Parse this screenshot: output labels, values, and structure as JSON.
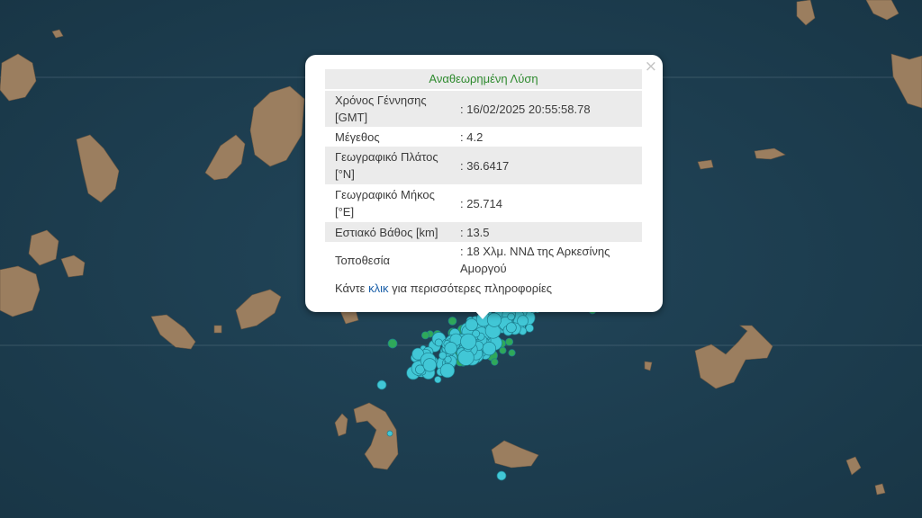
{
  "popup": {
    "title": "Αναθεωρημένη Λύση",
    "close_symbol": "×",
    "rows": [
      {
        "label": "Χρόνος Γέννησης [GMT]",
        "value": ": 16/02/2025 20:55:58.78"
      },
      {
        "label": "Μέγεθος",
        "value": ": 4.2"
      },
      {
        "label": "Γεωγραφικό Πλάτος [°N]",
        "value": ": 36.6417"
      },
      {
        "label": "Γεωγραφικό Μήκος [°E]",
        "value": ": 25.714"
      },
      {
        "label": "Εστιακό Βάθος [km]",
        "value": ": 13.5"
      },
      {
        "label": "Τοποθεσία",
        "value": ": 18 Χλμ. ΝΝΔ της Αρκεσίνης Αμοργού"
      }
    ],
    "more_prefix": "Κάντε ",
    "more_link": "κλικ",
    "more_suffix": " για περισσότερες πληροφορίες"
  },
  "colors": {
    "sea": "#1f3f52",
    "land": "#9b7e5f",
    "quake_recent": "#41c7d6",
    "quake_older": "#2fa85a",
    "title_green": "#2e8a2e",
    "link_blue": "#1a5fa8"
  }
}
